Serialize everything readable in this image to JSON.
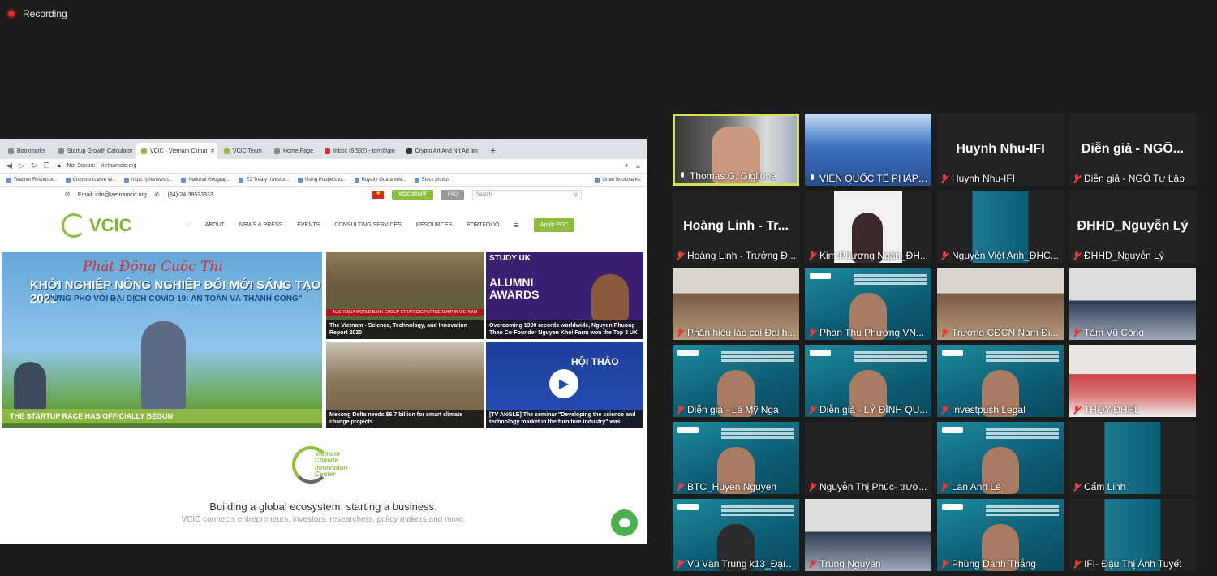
{
  "recording": {
    "label": "Recording"
  },
  "browser": {
    "tabs": [
      {
        "label": "Bookmarks",
        "active": false
      },
      {
        "label": "Startup Growth Calculator",
        "active": false
      },
      {
        "label": "VCIC - Vietnam Climat",
        "active": true
      },
      {
        "label": "VCIC Team",
        "active": false
      },
      {
        "label": "Home Page",
        "active": false
      },
      {
        "label": "Inbox (9,532) - tom@gio",
        "active": false
      },
      {
        "label": "Crypto Art And Nft Art lim",
        "active": false
      }
    ],
    "security": "Not Secure",
    "url": "vietnamcic.org",
    "bookmarks": [
      "Teacher Resource...",
      "Communicative W...",
      "https://previews.c...",
      "National Geograp...",
      "E2 Treaty Investor...",
      "Using Puppets to...",
      "Royalty Guarantee...",
      "Stock photos"
    ],
    "other_bookmarks": "Other Bookmarks"
  },
  "site": {
    "email": "Email: info@vietnamcic.org",
    "phone": "(84)-24-38533333",
    "staff_button": "VCIC STAFF",
    "faq_button": "FAQ",
    "search_placeholder": "Search",
    "logo_text": "VCIC",
    "logo_sub": "Vietnam Climate Innovation Center",
    "nav": [
      "ABOUT",
      "NEWS & PRESS",
      "EVENTS",
      "CONSULTING SERVICES",
      "RESOURCES",
      "PORTFOLIO"
    ],
    "apply_button": "Apply POC",
    "hero": {
      "line1": "Phát Động Cuộc Thi",
      "line2": "KHỞI NGHIỆP NÔNG NGHIỆP ĐỔI MỚI SÁNG TẠO 2021",
      "line3": "\"ỨNG PHÓ VỚI ĐẠI DỊCH COVID-19: AN TOÀN VÀ THÀNH CÔNG\"",
      "caption": "THE STARTUP RACE HAS OFFICIALLY BEGUN"
    },
    "cards": [
      {
        "caption": "The Vietnam - Science, Technology, and Innovation Report 2020",
        "tag": "AUSTRALIA WORLD BANK GROUP STRATEGIC PARTNERSHIP IN VIETNAM"
      },
      {
        "caption": "Overcoming 1300 records worldwide, Nguyen Phuong Thao Co-Founder Nguyen Khoi Farm won the Top 3 UK",
        "title": "STUDY UK",
        "sub": "ALUMNI AWARDS"
      },
      {
        "caption": "Mekong Delta needs $6.7 billion for smart climate change projects"
      },
      {
        "caption": "[TV ANGLE] The seminar \"Developing the science and technology market in the furniture industry\" was",
        "title": "HỘI THẢO"
      }
    ],
    "lower_logo": "Vietnam Climate Innovation Center",
    "slogan": "Building a global ecosystem, starting a business.",
    "sub_slogan": "VCIC connects entrepreneurs, investors, researchers, policy makers and more."
  },
  "participants": [
    {
      "name": "Thomas G. Giglione",
      "muted": false,
      "big": "",
      "style": "speaker"
    },
    {
      "name": "VIỆN QUỐC TẾ PHÁP NG...",
      "muted": false,
      "big": "",
      "style": "screen"
    },
    {
      "name": "Huynh Nhu-IFI",
      "muted": true,
      "big": "Huynh Nhu-IFI",
      "style": "blank"
    },
    {
      "name": "Diễn giả - NGÔ Tự Lập",
      "muted": true,
      "big": "Diễn giả - NGÔ...",
      "style": "blank"
    },
    {
      "name": "Hoàng Linh - Trưởng Đ...",
      "muted": true,
      "big": "Hoàng Linh - Tr...",
      "style": "blank"
    },
    {
      "name": "Kim Phương Ngân_ĐH...",
      "muted": true,
      "big": "",
      "style": "avatar"
    },
    {
      "name": "Nguyễn Việt Anh_ĐHC...",
      "muted": true,
      "big": "",
      "style": "isev-small"
    },
    {
      "name": "ĐHHD_Nguyễn Lý",
      "muted": true,
      "big": "ĐHHD_Nguyễn Lý",
      "style": "blank"
    },
    {
      "name": "Phân hiệu lào cai Đại h...",
      "muted": true,
      "big": "",
      "style": "room"
    },
    {
      "name": "Phan Thu Phương VN...",
      "muted": true,
      "big": "",
      "style": "isev"
    },
    {
      "name": "Trường CĐCN Nam Đi...",
      "muted": true,
      "big": "",
      "style": "room"
    },
    {
      "name": "Tâm Vũ Công",
      "muted": true,
      "big": "",
      "style": "room3"
    },
    {
      "name": "Diễn giả - Lê Mỹ Nga",
      "muted": true,
      "big": "",
      "style": "isev"
    },
    {
      "name": "Diễn giả - LÝ ĐÌNH QU...",
      "muted": true,
      "big": "",
      "style": "isev"
    },
    {
      "name": "Investpush Legal",
      "muted": true,
      "big": "",
      "style": "isev"
    },
    {
      "name": "THQY-ĐHHL",
      "muted": true,
      "big": "",
      "style": "room2"
    },
    {
      "name": "BTC_Huyen Nguyen",
      "muted": true,
      "big": "",
      "style": "isev"
    },
    {
      "name": "Nguyễn Thị Phúc- trườ...",
      "muted": true,
      "big": "",
      "style": "blank"
    },
    {
      "name": "Lan Anh Lê",
      "muted": true,
      "big": "",
      "style": "isev"
    },
    {
      "name": "Cẩm Linh",
      "muted": true,
      "big": "",
      "style": "isev-small"
    },
    {
      "name": "Vũ Văn Trung k13_Đại ...",
      "muted": true,
      "big": "",
      "style": "isev-dark"
    },
    {
      "name": "Trung Nguyen",
      "muted": true,
      "big": "",
      "style": "room3"
    },
    {
      "name": "Phùng Danh Thắng",
      "muted": true,
      "big": "",
      "style": "isev"
    },
    {
      "name": "IFI- Đậu Thị Ánh Tuyết",
      "muted": true,
      "big": "",
      "style": "isev-small"
    }
  ],
  "colors": {
    "accent": "#8cbf3f",
    "speaker_border": "#d4e157",
    "muted_icon": "#e23c3c",
    "background": "#1c1c1c"
  }
}
